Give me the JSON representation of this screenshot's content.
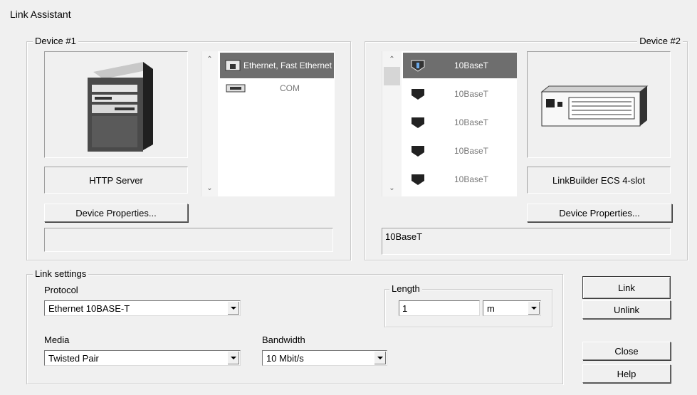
{
  "window": {
    "title": "Link Assistant"
  },
  "device1": {
    "legend": "Device #1",
    "name": "HTTP Server",
    "properties_button": "Device Properties...",
    "interfaces": [
      {
        "label": "Ethernet, Fast Ethernet",
        "icon": "ethernet-port-icon",
        "selected": true
      },
      {
        "label": "COM",
        "icon": "serial-port-icon",
        "selected": false
      }
    ]
  },
  "device2": {
    "legend": "Device #2",
    "name": "LinkBuilder ECS 4-slot",
    "properties_button": "Device Properties...",
    "status": "10BaseT",
    "ports": [
      {
        "label": "10BaseT",
        "selected": true
      },
      {
        "label": "10BaseT",
        "selected": false
      },
      {
        "label": "10BaseT",
        "selected": false
      },
      {
        "label": "10BaseT",
        "selected": false
      },
      {
        "label": "10BaseT",
        "selected": false
      }
    ]
  },
  "link_settings": {
    "legend": "Link settings",
    "protocol_label": "Protocol",
    "protocol_value": "Ethernet 10BASE-T",
    "media_label": "Media",
    "media_value": "Twisted Pair",
    "bandwidth_label": "Bandwidth",
    "bandwidth_value": "10 Mbit/s",
    "length_legend": "Length",
    "length_value": "1",
    "length_unit": "m"
  },
  "buttons": {
    "link": "Link",
    "unlink": "Unlink",
    "close": "Close",
    "help": "Help"
  }
}
